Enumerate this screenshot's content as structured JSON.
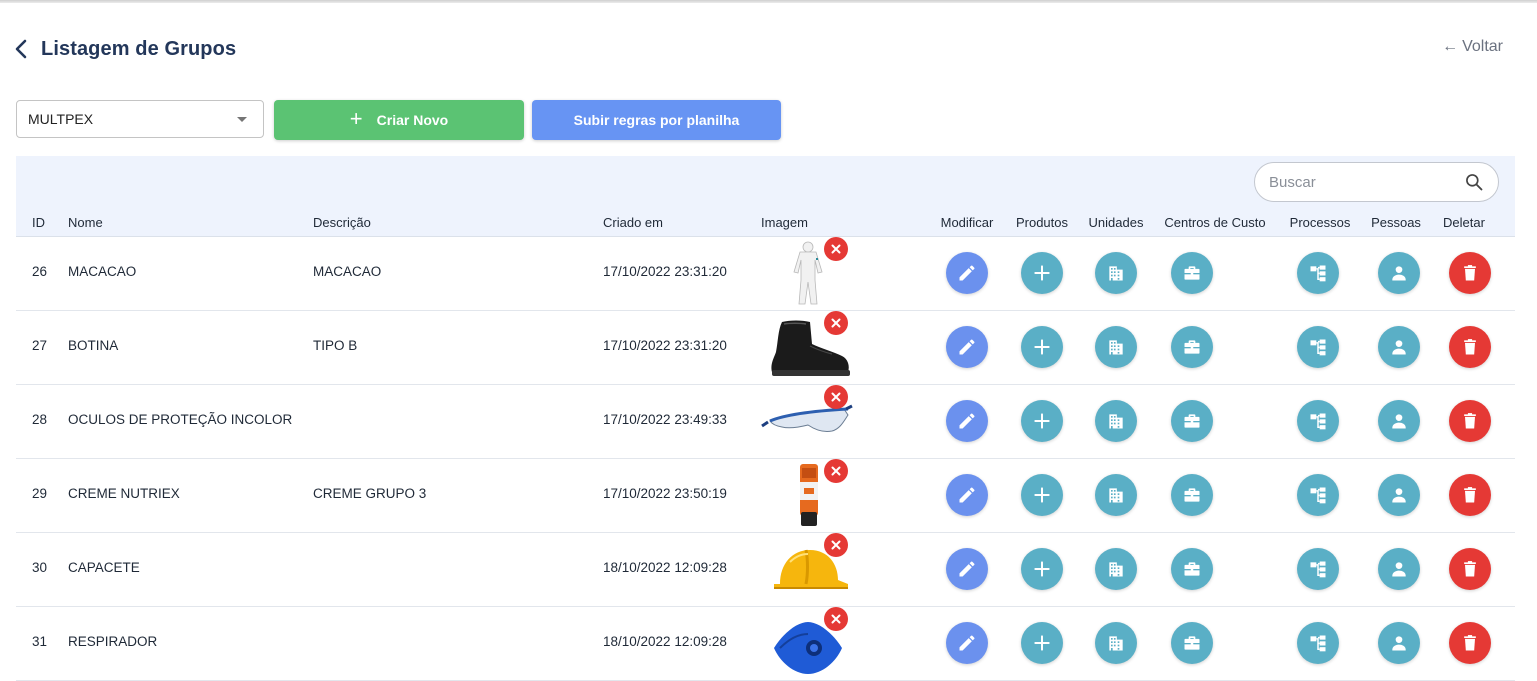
{
  "header": {
    "title": "Listagem de Grupos",
    "back_label": "Voltar"
  },
  "toolbar": {
    "company_select": "MULTPEX",
    "create_label": "Criar Novo",
    "upload_label": "Subir regras por planilha"
  },
  "search": {
    "placeholder": "Buscar"
  },
  "colors": {
    "green": "#5bc373",
    "blue": "#6794f3",
    "edit": "#6b91ee",
    "teal": "#5aafc6",
    "delete": "#e53935"
  },
  "table": {
    "columns": [
      "ID",
      "Nome",
      "Descrição",
      "Criado em",
      "Imagem",
      "Modificar",
      "Produtos",
      "Unidades",
      "Centros de Custo",
      "Processos",
      "Pessoas",
      "Deletar"
    ],
    "rows": [
      {
        "id": "26",
        "name": "MACACAO",
        "description": "MACACAO",
        "created": "17/10/2022 23:31:20",
        "image": "coverall-image"
      },
      {
        "id": "27",
        "name": "BOTINA",
        "description": "TIPO B",
        "created": "17/10/2022 23:31:20",
        "image": "boot-image"
      },
      {
        "id": "28",
        "name": "OCULOS DE PROTEÇÃO INCOLOR",
        "description": "",
        "created": "17/10/2022 23:49:33",
        "image": "goggles-image"
      },
      {
        "id": "29",
        "name": "CREME NUTRIEX",
        "description": "CREME GRUPO 3",
        "created": "17/10/2022 23:50:19",
        "image": "cream-tube-image"
      },
      {
        "id": "30",
        "name": "CAPACETE",
        "description": "",
        "created": "18/10/2022 12:09:28",
        "image": "helmet-image"
      },
      {
        "id": "31",
        "name": "RESPIRADOR",
        "description": "",
        "created": "18/10/2022 12:09:28",
        "image": "respirator-image"
      }
    ]
  }
}
